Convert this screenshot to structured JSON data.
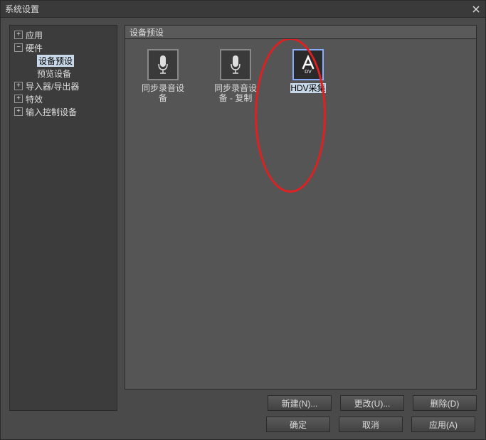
{
  "window": {
    "title": "系统设置"
  },
  "sidebar": {
    "items": [
      {
        "label": "应用",
        "expand": "plus",
        "level": 1
      },
      {
        "label": "硬件",
        "expand": "minus",
        "level": 1
      },
      {
        "label": "设备预设",
        "expand": "",
        "level": 2,
        "selected": true
      },
      {
        "label": "预览设备",
        "expand": "",
        "level": 2
      },
      {
        "label": "导入器/导出器",
        "expand": "plus",
        "level": 1
      },
      {
        "label": "特效",
        "expand": "plus",
        "level": 1
      },
      {
        "label": "输入控制设备",
        "expand": "plus",
        "level": 1
      }
    ]
  },
  "panel": {
    "header": "设备预设",
    "presets": [
      {
        "label": "同步录音设备",
        "icon": "mic"
      },
      {
        "label": "同步录音设备 - 复制",
        "icon": "mic"
      },
      {
        "label": "HDV采集",
        "icon": "adv",
        "selected": true
      }
    ],
    "buttons": {
      "new": "新建(N)...",
      "change": "更改(U)...",
      "delete": "删除(D)"
    }
  },
  "dialog": {
    "ok": "确定",
    "cancel": "取消",
    "apply": "应用(A)"
  }
}
